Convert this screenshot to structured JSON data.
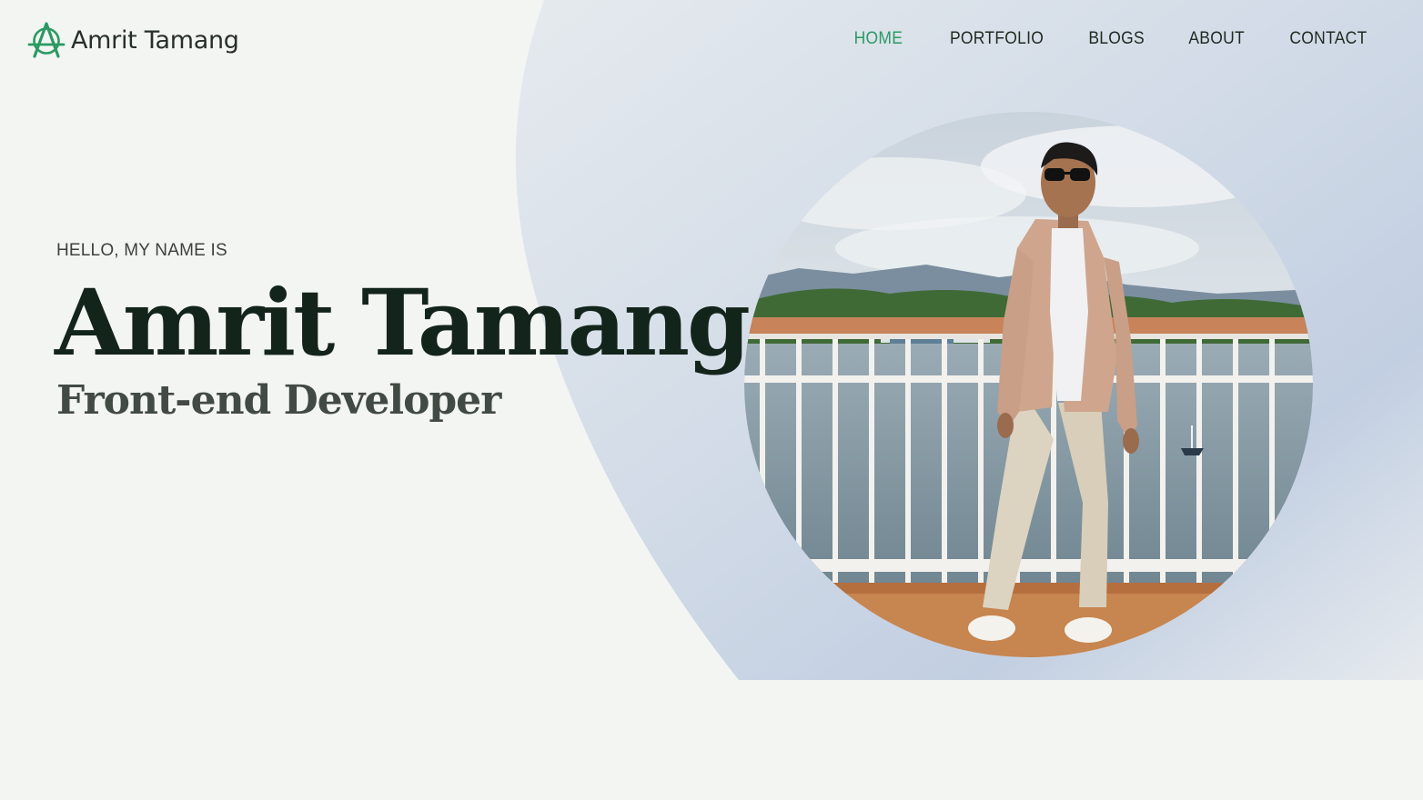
{
  "brand": {
    "name": "Amrit Tamang",
    "logo_icon": "anarchy-a-icon",
    "accent_color": "#2a9a63"
  },
  "nav": {
    "items": [
      {
        "label": "HOME",
        "active": true
      },
      {
        "label": "PORTFOLIO",
        "active": false
      },
      {
        "label": "BLOGS",
        "active": false
      },
      {
        "label": "ABOUT",
        "active": false
      },
      {
        "label": "CONTACT",
        "active": false
      }
    ]
  },
  "hero": {
    "greeting": "HELLO, MY NAME IS",
    "name": "Amrit Tamang",
    "role": "Front-end Developer",
    "photo": "profile-photo"
  }
}
